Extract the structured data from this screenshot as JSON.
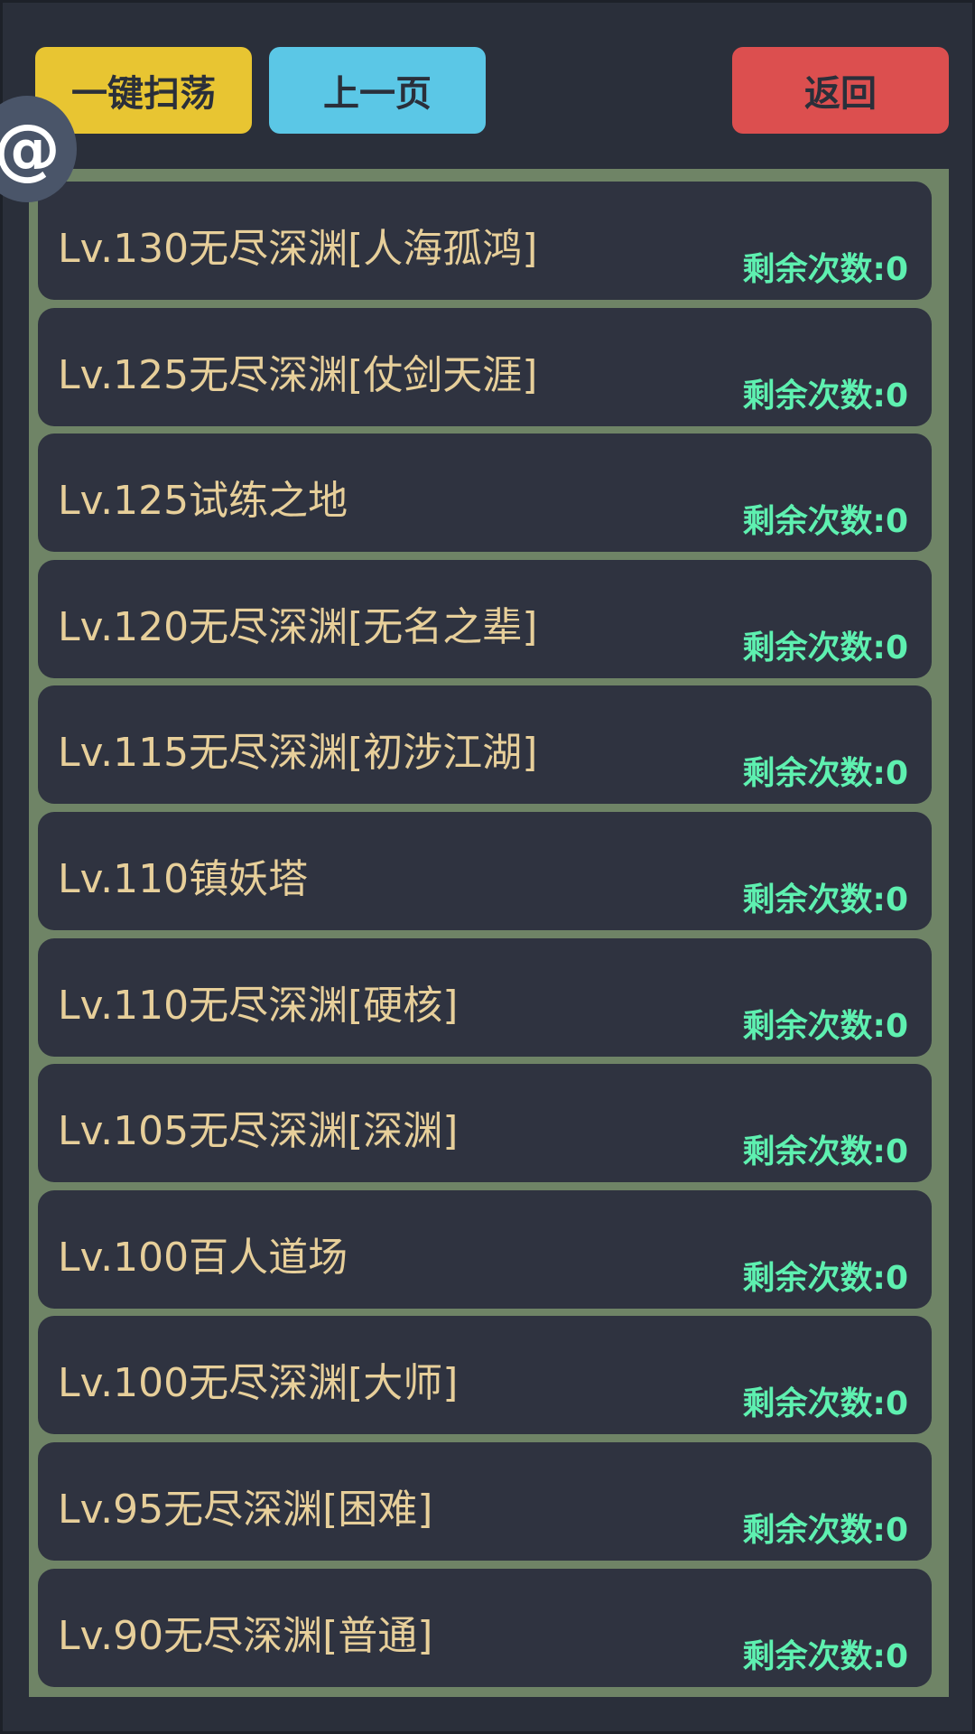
{
  "toolbar": {
    "sweep_label": "一键扫荡",
    "prev_page_label": "上一页",
    "back_label": "返回"
  },
  "floating": {
    "at_symbol": "@"
  },
  "levels": [
    {
      "name": "Lv.130无尽深渊[人海孤鸿]",
      "count": "剩余次数:0"
    },
    {
      "name": "Lv.125无尽深渊[仗剑天涯]",
      "count": "剩余次数:0"
    },
    {
      "name": "Lv.125试练之地",
      "count": "剩余次数:0"
    },
    {
      "name": "Lv.120无尽深渊[无名之辈]",
      "count": "剩余次数:0"
    },
    {
      "name": "Lv.115无尽深渊[初涉江湖]",
      "count": "剩余次数:0"
    },
    {
      "name": "Lv.110镇妖塔",
      "count": "剩余次数:0"
    },
    {
      "name": "Lv.110无尽深渊[硬核]",
      "count": "剩余次数:0"
    },
    {
      "name": "Lv.105无尽深渊[深渊]",
      "count": "剩余次数:0"
    },
    {
      "name": "Lv.100百人道场",
      "count": "剩余次数:0"
    },
    {
      "name": "Lv.100无尽深渊[大师]",
      "count": "剩余次数:0"
    },
    {
      "name": "Lv.95无尽深渊[困难]",
      "count": "剩余次数:0"
    },
    {
      "name": "Lv.90无尽深渊[普通]",
      "count": "剩余次数:0"
    }
  ],
  "colors": {
    "background": "#2a2f3a",
    "sweep_button": "#e8c532",
    "prev_button": "#5bc7e6",
    "back_button": "#dc4f4f",
    "panel_border": "#6f8466",
    "item_bg": "#2f3340",
    "item_name": "#e7cf9a",
    "item_count": "#5ef0b0"
  }
}
